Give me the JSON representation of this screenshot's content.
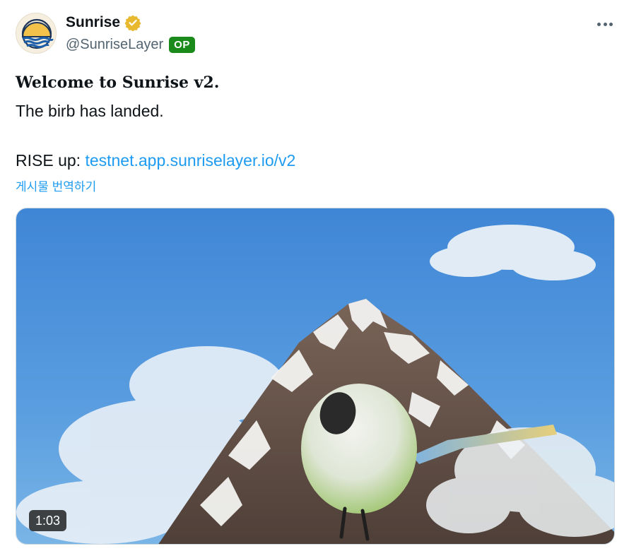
{
  "author": {
    "display_name": "Sunrise",
    "handle": "@SunriseLayer",
    "op_badge": "OP",
    "avatar_icon": "sunrise-logo-icon",
    "verified_icon": "verified-badge-icon",
    "verified_color": "#e8b92f"
  },
  "post": {
    "headline": "Welcome to Sunrise v2.",
    "line2": "The birb has landed.",
    "line4_prefix": "RISE up: ",
    "link_text": "testnet.app.sunriselayer.io/v2",
    "translate_label": "게시물 번역하기"
  },
  "media": {
    "type": "video",
    "duration": "1:03",
    "scene_description_icon": "video-thumbnail"
  },
  "colors": {
    "link": "#1d9bf0",
    "op_badge": "#1a8a1a",
    "secondary_text": "#536471"
  }
}
